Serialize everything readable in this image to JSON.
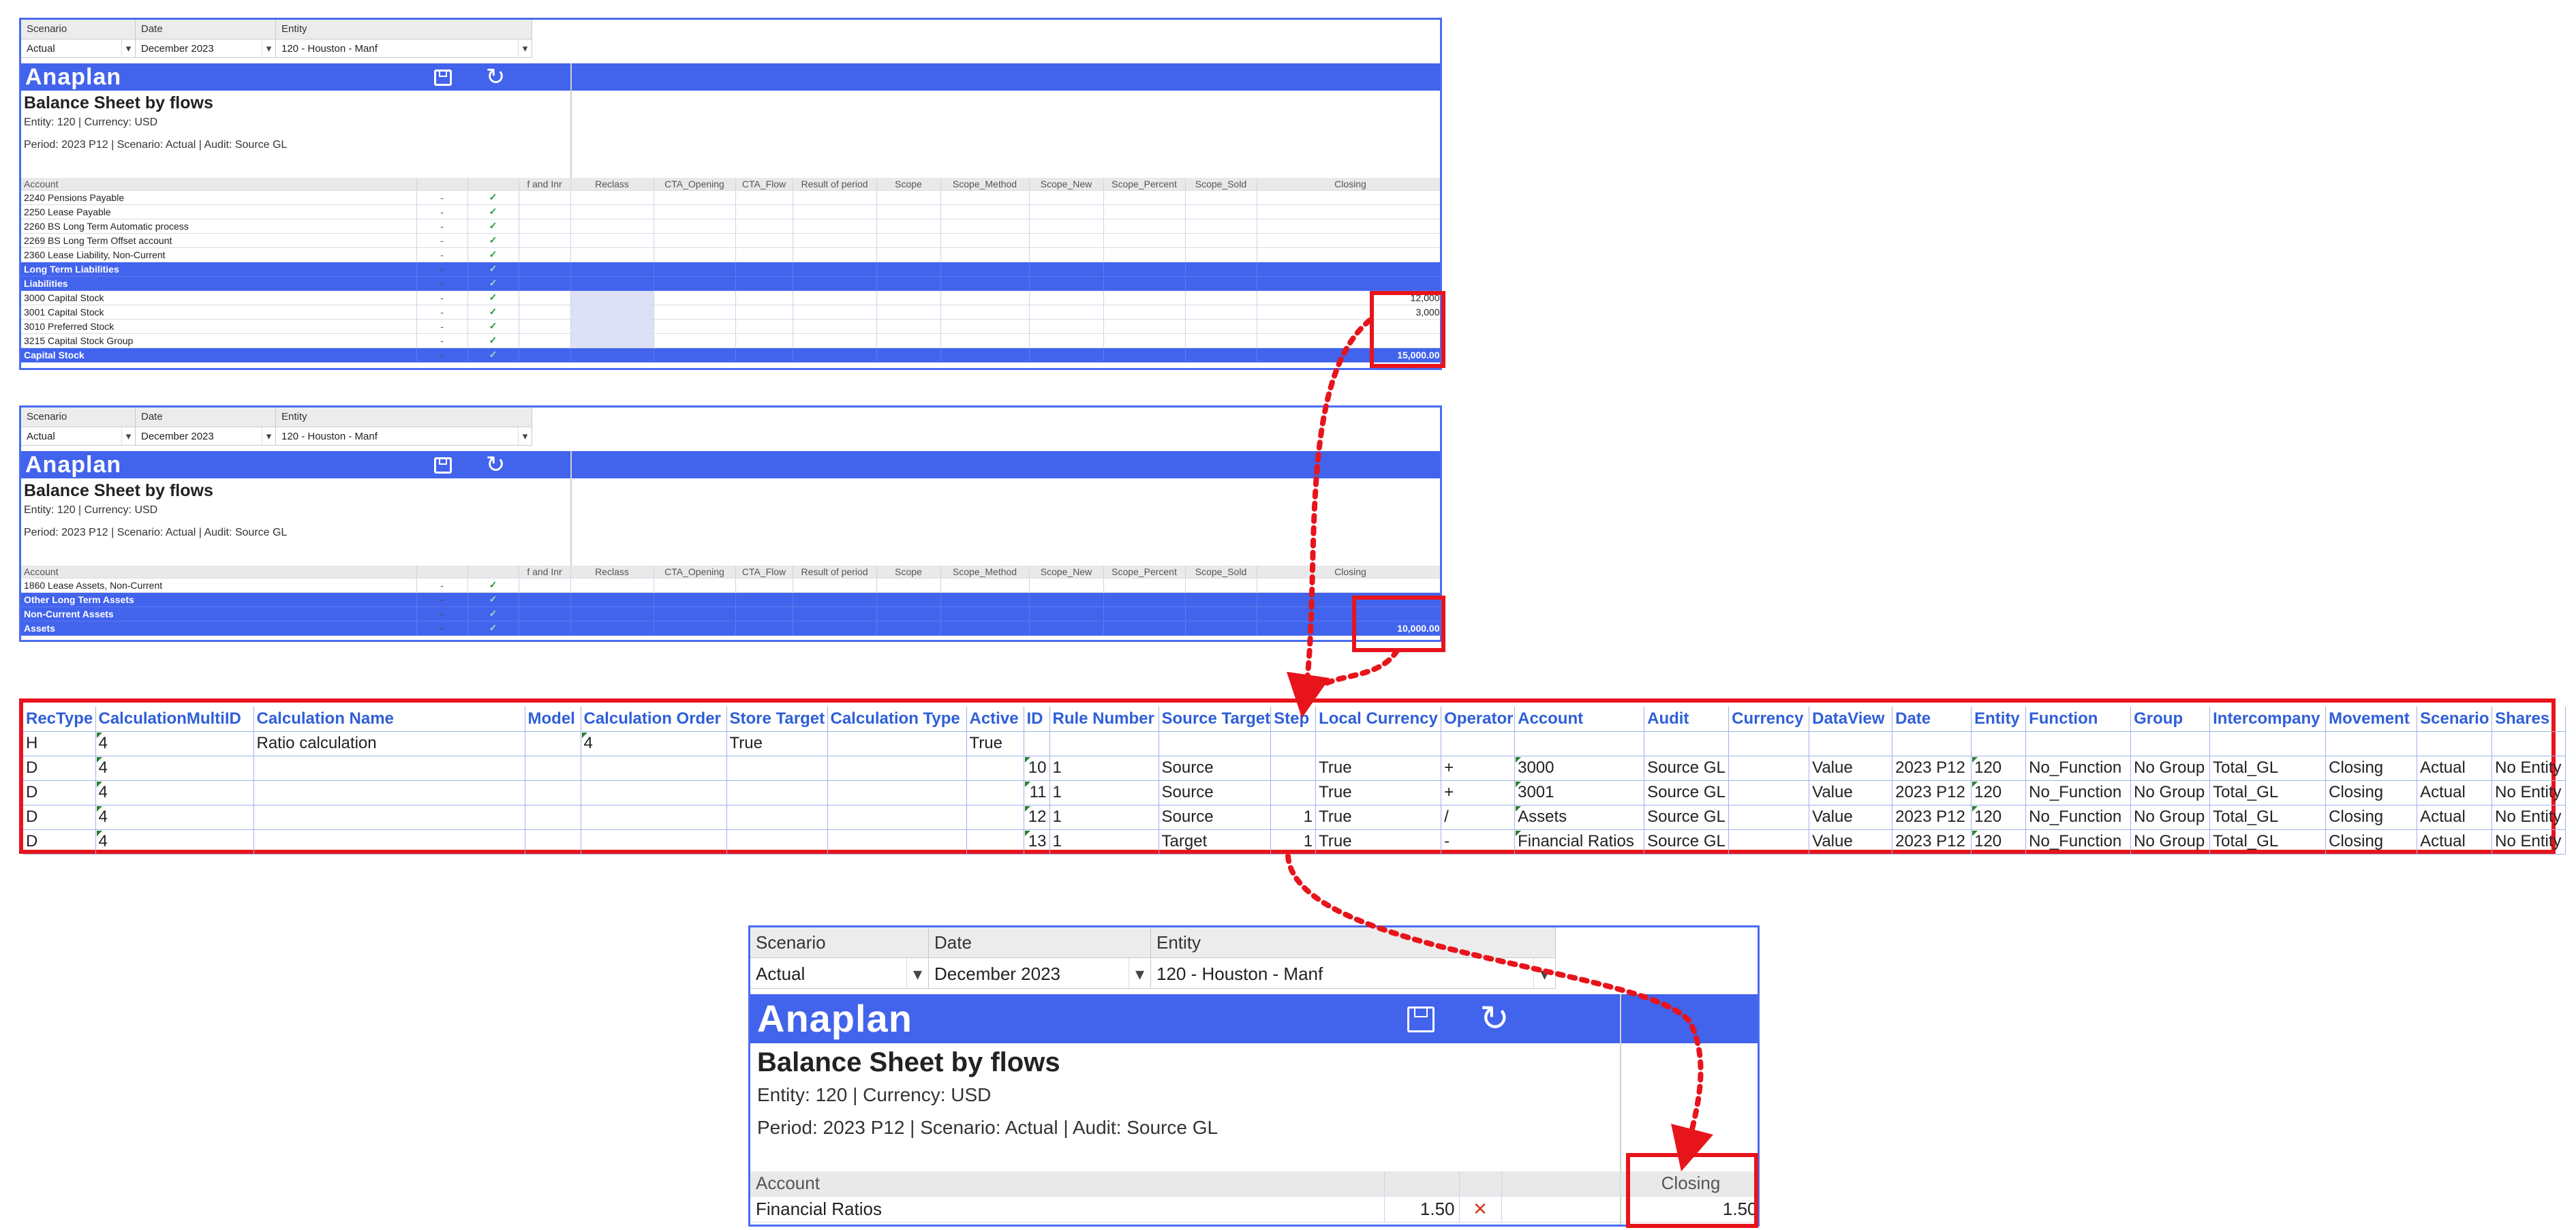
{
  "screen1": {
    "filters": {
      "scenario_label": "Scenario",
      "scenario_value": "Actual",
      "date_label": "Date",
      "date_value": "December 2023",
      "entity_label": "Entity",
      "entity_value": "120 - Houston - Manf"
    },
    "logo": "Anaplan",
    "title": "Balance Sheet by flows",
    "sub1": "Entity: 120 | Currency: USD",
    "sub2": "Period: 2023 P12 | Scenario: Actual | Audit: Source GL",
    "headers": [
      "Account",
      "",
      "",
      "f and Inr",
      "Reclass",
      "CTA_Opening",
      "CTA_Flow",
      "Result of period",
      "Scope",
      "Scope_Method",
      "Scope_New",
      "Scope_Percent",
      "Scope_Sold",
      "Closing"
    ],
    "rows": [
      {
        "account": "2240 Pensions Payable",
        "dash": "-",
        "closing": "",
        "sum": false
      },
      {
        "account": "2250 Lease Payable",
        "dash": "-",
        "closing": "",
        "sum": false
      },
      {
        "account": "2260 BS Long Term Automatic process",
        "dash": "-",
        "closing": "",
        "sum": false
      },
      {
        "account": "2269 BS Long Term Offset account",
        "dash": "-",
        "closing": "",
        "sum": false
      },
      {
        "account": "2360 Lease Liability, Non-Current",
        "dash": "-",
        "closing": "",
        "sum": false
      },
      {
        "account": "Long Term Liabilities",
        "dash": "-",
        "closing": "",
        "sum": true
      },
      {
        "account": "Liabilities",
        "dash": "-",
        "closing": "",
        "sum": true
      },
      {
        "account": "3000 Capital Stock",
        "dash": "-",
        "closing": "12,000",
        "sum": false
      },
      {
        "account": "3001 Capital Stock",
        "dash": "-",
        "closing": "3,000",
        "sum": false
      },
      {
        "account": "3010 Preferred Stock",
        "dash": "-",
        "closing": "",
        "sum": false
      },
      {
        "account": "3215 Capital Stock Group",
        "dash": "-",
        "closing": "",
        "sum": false
      },
      {
        "account": "Capital Stock",
        "dash": "-",
        "closing": "15,000.00",
        "sum": true
      }
    ]
  },
  "screen2": {
    "filters": {
      "scenario_label": "Scenario",
      "scenario_value": "Actual",
      "date_label": "Date",
      "date_value": "December 2023",
      "entity_label": "Entity",
      "entity_value": "120 - Houston - Manf"
    },
    "logo": "Anaplan",
    "title": "Balance Sheet by flows",
    "sub1": "Entity: 120 | Currency: USD",
    "sub2": "Period: 2023 P12 | Scenario: Actual | Audit: Source GL",
    "headers": [
      "Account",
      "",
      "",
      "f and Inr",
      "Reclass",
      "CTA_Opening",
      "CTA_Flow",
      "Result of period",
      "Scope",
      "Scope_Method",
      "Scope_New",
      "Scope_Percent",
      "Scope_Sold",
      "Closing"
    ],
    "rows": [
      {
        "account": "1860 Lease Assets, Non-Current",
        "dash": "-",
        "closing": "",
        "sum": false
      },
      {
        "account": "Other Long Term Assets",
        "dash": "-",
        "closing": "",
        "sum": true
      },
      {
        "account": "Non-Current Assets",
        "dash": "-",
        "closing": "",
        "sum": true
      },
      {
        "account": "Assets",
        "dash": "-",
        "closing": "10,000.00",
        "sum": true
      }
    ]
  },
  "calc_table": {
    "headers": [
      "RecType",
      "CalculationMultiID",
      "Calculation Name",
      "Model",
      "Calculation Order",
      "Store Target",
      "Calculation Type",
      "Active",
      "ID",
      "Rule Number",
      "Source Target",
      "Step",
      "Local Currency",
      "Operator",
      "Account",
      "Audit",
      "Currency",
      "DataView",
      "Date",
      "Entity",
      "Function",
      "Group",
      "Intercompany",
      "Movement",
      "Scenario",
      "Shares"
    ],
    "rows": [
      [
        "H",
        "4",
        "Ratio calculation",
        "",
        "4",
        "True",
        "",
        "True",
        "",
        "",
        "",
        "",
        "",
        "",
        "",
        "",
        "",
        "",
        "",
        "",
        "",
        "",
        "",
        "",
        "",
        ""
      ],
      [
        "D",
        "4",
        "",
        "",
        "",
        "",
        "",
        "",
        "10",
        "1",
        "Source",
        "",
        "True",
        "+",
        "3000",
        "Source GL",
        "",
        "Value",
        "2023 P12",
        "120",
        "No_Function",
        "No Group",
        "Total_GL",
        "Closing",
        "Actual",
        "No Entity"
      ],
      [
        "D",
        "4",
        "",
        "",
        "",
        "",
        "",
        "",
        "11",
        "1",
        "Source",
        "",
        "True",
        "+",
        "3001",
        "Source GL",
        "",
        "Value",
        "2023 P12",
        "120",
        "No_Function",
        "No Group",
        "Total_GL",
        "Closing",
        "Actual",
        "No Entity"
      ],
      [
        "D",
        "4",
        "",
        "",
        "",
        "",
        "",
        "",
        "12",
        "1",
        "Source",
        "1",
        "True",
        "/",
        "Assets",
        "Source GL",
        "",
        "Value",
        "2023 P12",
        "120",
        "No_Function",
        "No Group",
        "Total_GL",
        "Closing",
        "Actual",
        "No Entity"
      ],
      [
        "D",
        "4",
        "",
        "",
        "",
        "",
        "",
        "",
        "13",
        "1",
        "Target",
        "1",
        "True",
        "-",
        "Financial Ratios",
        "Source GL",
        "",
        "Value",
        "2023 P12",
        "120",
        "No_Function",
        "No Group",
        "Total_GL",
        "Closing",
        "Actual",
        "No Entity"
      ]
    ]
  },
  "screen3": {
    "filters": {
      "scenario_label": "Scenario",
      "scenario_value": "Actual",
      "date_label": "Date",
      "date_value": "December 2023",
      "entity_label": "Entity",
      "entity_value": "120 - Houston - Manf"
    },
    "logo": "Anaplan",
    "title": "Balance Sheet by flows",
    "sub1": "Entity: 120 | Currency: USD",
    "sub2": "Period: 2023 P12 | Scenario: Actual | Audit: Source GL",
    "account_header": "Account",
    "closing_header": "Closing",
    "row": {
      "account": "Financial Ratios",
      "value": "1.50",
      "closing": "1.50"
    }
  },
  "colors": {
    "brand_blue": "#4263ec",
    "highlight_red": "#e8141c",
    "check_green": "#1a9a3a",
    "x_red": "#d23b1f",
    "header_blue_text": "#2f5fd8"
  }
}
